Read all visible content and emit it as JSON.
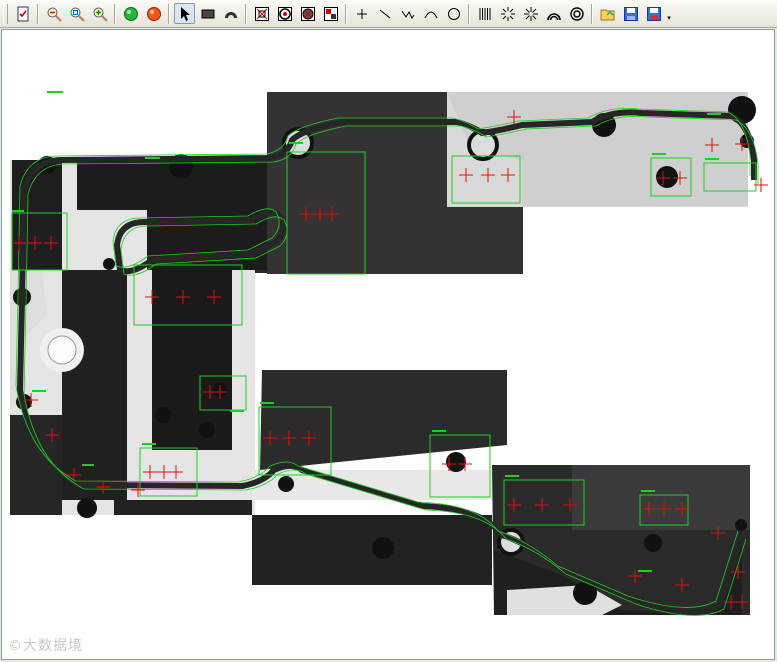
{
  "toolbar": {
    "buttons": [
      {
        "name": "checklist-icon"
      },
      {
        "name": "zoom-out-icon"
      },
      {
        "name": "zoom-fit-icon"
      },
      {
        "name": "zoom-in-icon"
      },
      {
        "name": "run-green-icon"
      },
      {
        "name": "stop-red-icon"
      },
      {
        "name": "pointer-icon"
      },
      {
        "name": "rectangle-tool-icon"
      },
      {
        "name": "arc-tool-icon"
      },
      {
        "name": "measure-rect-icon"
      },
      {
        "name": "measure-ring-icon"
      },
      {
        "name": "measure-circle-icon"
      },
      {
        "name": "measure-quad-icon"
      },
      {
        "name": "crosshair-icon"
      },
      {
        "name": "line-tool-icon"
      },
      {
        "name": "polyline-tool-icon"
      },
      {
        "name": "curve-tool-icon"
      },
      {
        "name": "circle-tool-icon"
      },
      {
        "name": "rake-tool-icon"
      },
      {
        "name": "spoke-tool-icon"
      },
      {
        "name": "star-tool-icon"
      },
      {
        "name": "concentric-arc-icon"
      },
      {
        "name": "concentric-ring-icon"
      },
      {
        "name": "open-file-icon"
      },
      {
        "name": "save-icon"
      },
      {
        "name": "save-as-icon"
      }
    ],
    "dropdown_glyph": "▾"
  },
  "canvas": {
    "colors": {
      "background": "#ffffff",
      "part_dark": "#222222",
      "part_light": "#d8d8d8",
      "roi": "#22cc22",
      "cross": "#dd1111"
    }
  },
  "watermark": "©大数据境"
}
